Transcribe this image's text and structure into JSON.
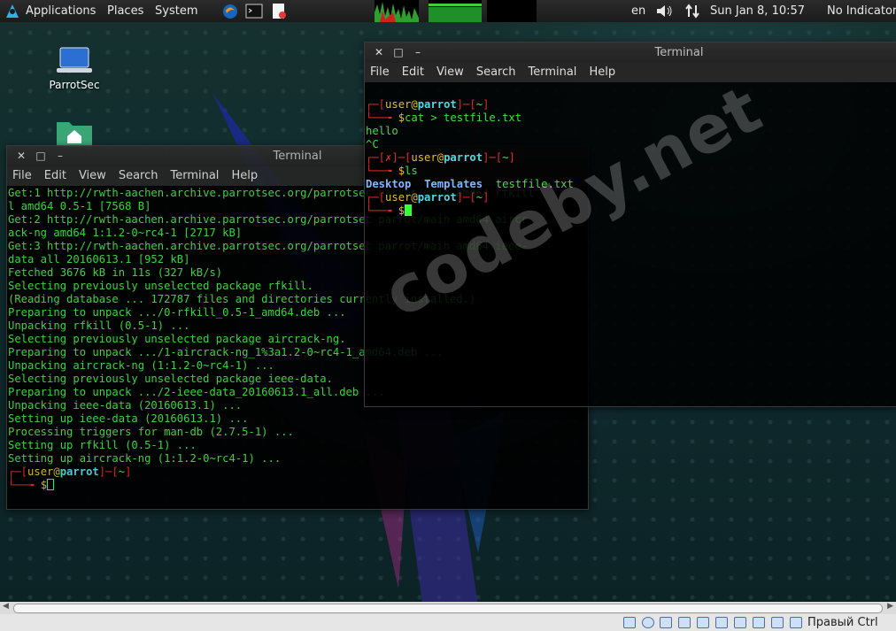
{
  "top_panel": {
    "menus": [
      "Applications",
      "Places",
      "System"
    ],
    "keyboard_layout": "en",
    "clock": "Sun Jan  8, 10:57",
    "indicator": "No Indicator"
  },
  "desktop": {
    "icons": [
      {
        "label": "ParrotSec",
        "icon": "laptop-icon"
      },
      {
        "label": "",
        "icon": "home-folder-icon"
      }
    ]
  },
  "back_terminal": {
    "title": "Terminal",
    "menu": [
      "File",
      "Edit",
      "View",
      "Search",
      "Terminal",
      "Help"
    ],
    "lines": [
      "Get:1 http://rwth-aachen.archive.parrotsec.org/parrotsec parrot/main amd64 rfkill",
      "l amd64 0.5-1 [7568 B]",
      "Get:2 http://rwth-aachen.archive.parrotsec.org/parrotsec parrot/main amd64 aircr",
      "ack-ng amd64 1:1.2-0~rc4-1 [2717 kB]",
      "Get:3 http://rwth-aachen.archive.parrotsec.org/parrotsec parrot/main amd64 ieee-",
      "data all 20160613.1 [952 kB]",
      "Fetched 3676 kB in 11s (327 kB/s)",
      "Selecting previously unselected package rfkill.",
      "(Reading database ... 172787 files and directories currently installed.)",
      "Preparing to unpack .../0-rfkill_0.5-1_amd64.deb ...",
      "Unpacking rfkill (0.5-1) ...",
      "Selecting previously unselected package aircrack-ng.",
      "Preparing to unpack .../1-aircrack-ng_1%3a1.2-0~rc4-1_amd64.deb ...",
      "Unpacking aircrack-ng (1:1.2-0~rc4-1) ...",
      "Selecting previously unselected package ieee-data.",
      "Preparing to unpack .../2-ieee-data_20160613.1_all.deb ...",
      "Unpacking ieee-data (20160613.1) ...",
      "Setting up ieee-data (20160613.1) ...",
      "Processing triggers for man-db (2.7.5-1) ...",
      "Setting up rfkill (0.5-1) ...",
      "Setting up aircrack-ng (1:1.2-0~rc4-1) ..."
    ],
    "prompt": {
      "user": "user",
      "at": "@",
      "host": "parrot",
      "dir": "~",
      "symbol": "$"
    }
  },
  "front_terminal": {
    "title": "Terminal",
    "menu": [
      "File",
      "Edit",
      "View",
      "Search",
      "Terminal",
      "Help"
    ],
    "prompt": {
      "user": "user",
      "at": "@",
      "host": "parrot",
      "dir": "~",
      "symbol": "$",
      "error_mark": "✗"
    },
    "cmd1": "cat > testfile.txt",
    "out1": "hello",
    "out2": "^C",
    "cmd2": "ls",
    "ls_dirs": [
      "Desktop",
      "Templates"
    ],
    "ls_file": "testfile.txt"
  },
  "watermark": "codeby.net",
  "statusbar": {
    "host_key": "Правый Ctrl"
  },
  "colors": {
    "terminal_green": "#3ee03e",
    "prompt_red": "#e02828",
    "host_yellow": "#e0c020",
    "dir_blue": "#7fb6ff"
  }
}
